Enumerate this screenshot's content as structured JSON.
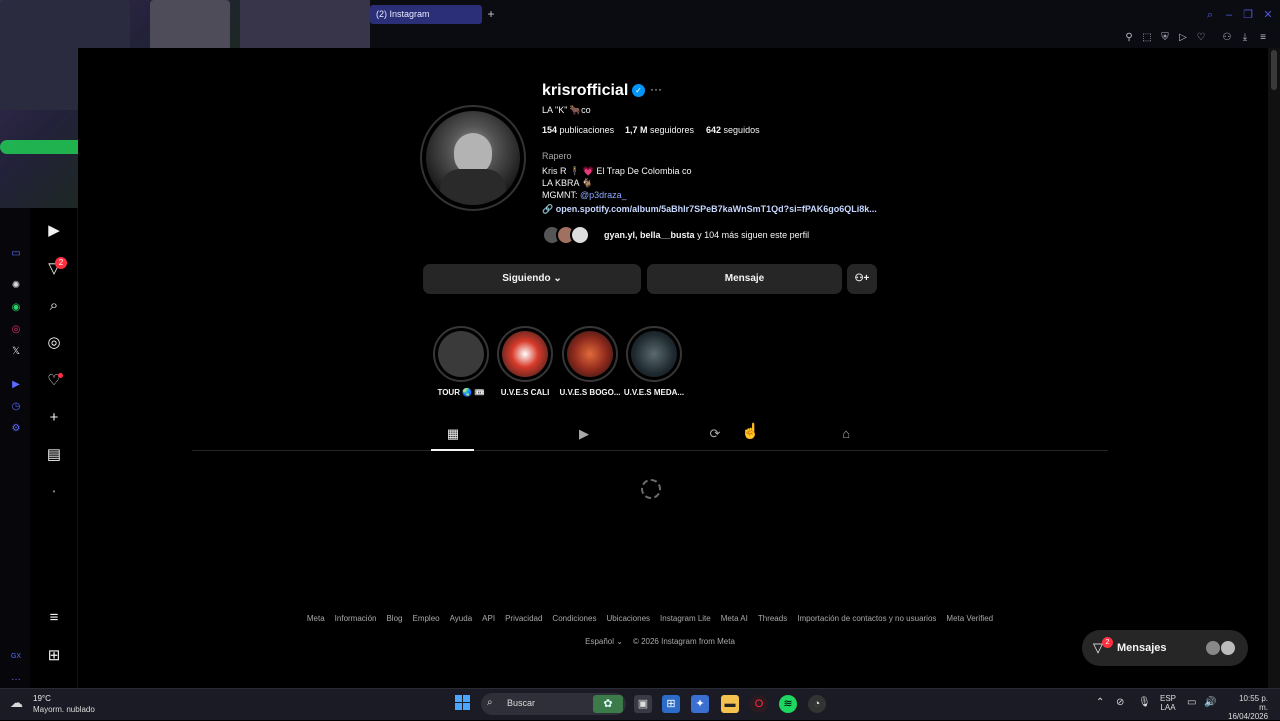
{
  "browser": {
    "tab_title": "(2) Instagram",
    "new_tab": "+"
  },
  "profile": {
    "username": "krisrofficial",
    "verified": "✓",
    "more": "···",
    "tagline": "LA \"K\" 🐂co",
    "posts_count": "154",
    "posts_label": "publicaciones",
    "followers_count": "1,7 M",
    "followers_label": "seguidores",
    "following_count": "642",
    "following_label": "seguidos",
    "category": "Rapero",
    "bio_line1": "Kris R 🕴 💗 El Trap De Colombia co",
    "bio_line2": "LA KBRA 🐐",
    "bio_line3_prefix": "MGMNT:",
    "bio_line3_mention": "@p3draza_",
    "link": "open.spotify.com/album/5aBhlr7SPeB7kaWnSmT1Qd?si=fPAK6go6QLi8k...",
    "followed_by_names": "gyan.yl, bella__busta",
    "followed_by_rest": "y 104 más siguen este perfil"
  },
  "actions": {
    "following": "Siguiendo ⌄",
    "message": "Mensaje",
    "suggest_icon": "person-add-icon"
  },
  "highlights": [
    {
      "label": "TOUR 🌏 🎟",
      "color": "#3a3a3a"
    },
    {
      "label": "U.V.E.S CALI",
      "color": "#b5251e"
    },
    {
      "label": "U.V.E.S BOGO...",
      "color": "#8f2a1d"
    },
    {
      "label": "U.V.E.S MEDA...",
      "color": "#1f2a30"
    }
  ],
  "footer": {
    "links": [
      "Meta",
      "Información",
      "Blog",
      "Empleo",
      "Ayuda",
      "API",
      "Privacidad",
      "Condiciones",
      "Ubicaciones",
      "Instagram Lite",
      "Meta AI",
      "Threads",
      "Importación de contactos y no usuarios",
      "Meta Verified"
    ],
    "language": "Español ⌄",
    "copyright": "© 2026 Instagram from Meta"
  },
  "messages": {
    "label": "Mensajes",
    "badge": "2"
  },
  "nav": {
    "notif_badge": "2"
  },
  "taskbar": {
    "temp": "19°C",
    "weather": "Mayorm. nublado",
    "search": "Buscar",
    "lang1": "ESP",
    "lang2": "LAA",
    "time": "10:55 p. m.",
    "date": "16/04/2026"
  },
  "colors": {
    "accent": "#0095f6",
    "badge": "#ff3040",
    "opera_blue": "#4d59d6"
  }
}
